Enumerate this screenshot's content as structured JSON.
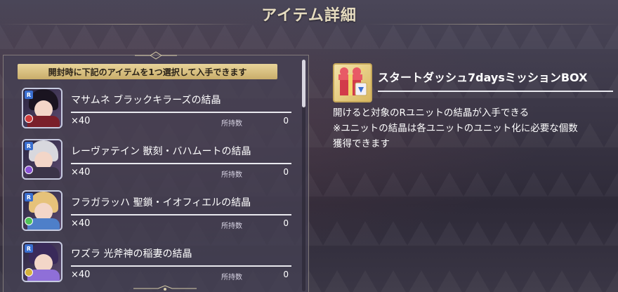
{
  "header": {
    "title": "アイテム詳細"
  },
  "list": {
    "notice": "開封時に下記のアイテムを1つ選択して入手できます",
    "owned_label": "所持数",
    "items": [
      {
        "name": "マサムネ ブラックキラーズの結晶",
        "qty": "×40",
        "owned": "0",
        "rarity": "R",
        "hair": "#1a1420",
        "outfit": "#7a1f2a",
        "element": "#d23c3c"
      },
      {
        "name": "レーヴァテイン 獣刻・バハムートの結晶",
        "qty": "×40",
        "owned": "0",
        "rarity": "R",
        "hair": "#d8d8de",
        "outfit": "#3b3448",
        "element": "#8a52d6"
      },
      {
        "name": "フラガラッハ 聖鎖・イオフィエルの結晶",
        "qty": "×40",
        "owned": "0",
        "rarity": "R",
        "hair": "#e6c27a",
        "outfit": "#4e7fc9",
        "element": "#4fc25a"
      },
      {
        "name": "ワズラ 光斧神の稲妻の結晶",
        "qty": "×40",
        "owned": "0",
        "rarity": "R",
        "hair": "#3a2a5a",
        "outfit": "#8f6fd8",
        "element": "#d6b23c"
      }
    ]
  },
  "detail": {
    "title": "スタートダッシュ7daysミッションBOX",
    "description": "開けると対象のRユニットの結晶が入手できる\n※ユニットの結晶は各ユニットのユニット化に必要な個数\n獲得できます"
  },
  "colors": {
    "gold": "#e6dcc0",
    "notice_bg": "#d8c282",
    "panel_bg": "#464254",
    "rule": "#e9e9ef"
  }
}
